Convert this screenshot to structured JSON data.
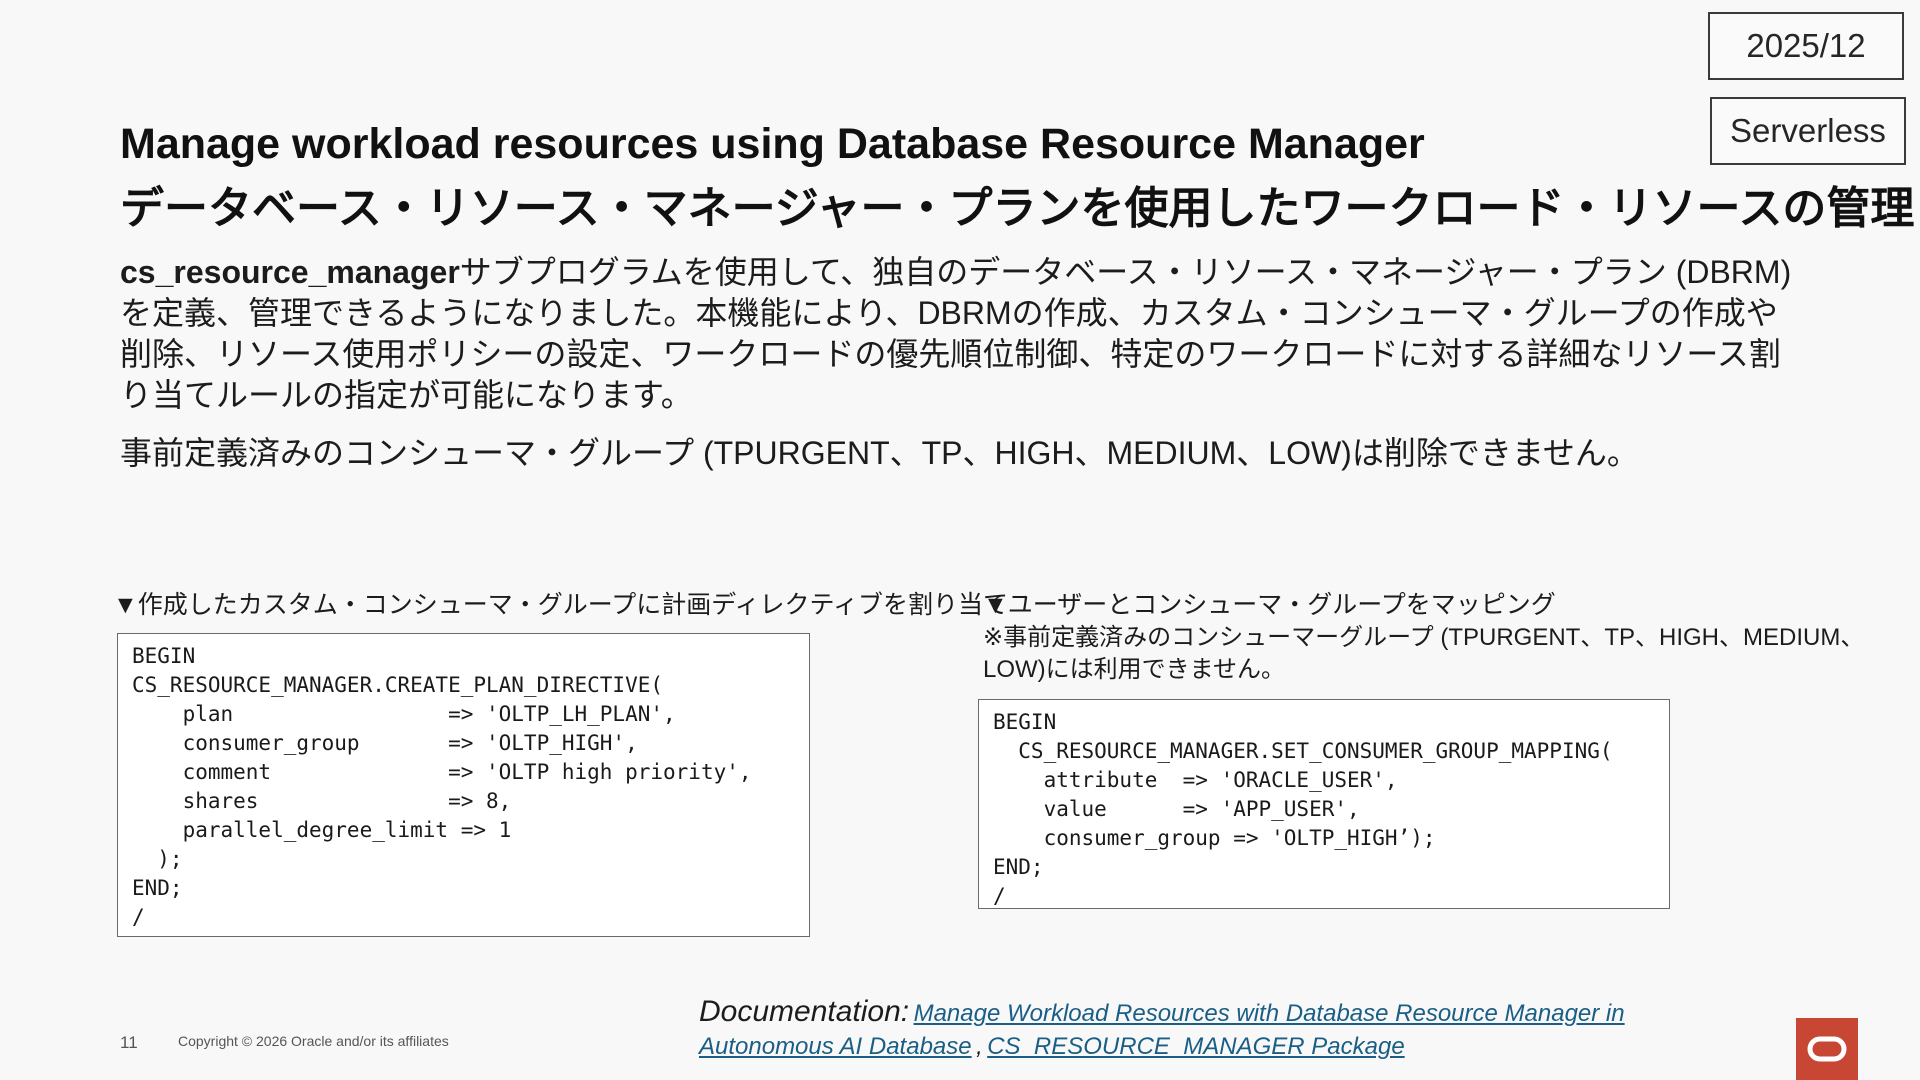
{
  "badges": {
    "date": "2025/12",
    "type": "Serverless"
  },
  "title": {
    "en": "Manage workload resources using Database Resource Manager",
    "ja": "データベース・リソース・マネージャー・プランを使用したワークロード・リソースの管理"
  },
  "body": {
    "bold_prefix": "cs_resource_manager",
    "para1_rest": "サブプログラムを使用して、独自のデータベース・リソース・マネージャー・プラン (DBRM)を定義、管理できるようになりました。本機能により、DBRMの作成、カスタム・コンシューマ・グループの作成や削除、リソース使用ポリシーの設定、ワークロードの優先順位制御、特定のワークロードに対する詳細なリソース割り当てルールの指定が可能になります。",
    "para2": "事前定義済みのコンシューマ・グループ (TPURGENT、TP、HIGH、MEDIUM、LOW)は削除できません。"
  },
  "left_section": {
    "heading": "▼作成したカスタム・コンシューマ・グループに計画ディレクティブを割り当て",
    "code": [
      "BEGIN",
      "CS_RESOURCE_MANAGER.CREATE_PLAN_DIRECTIVE(",
      "    plan                 => 'OLTP_LH_PLAN',",
      "    consumer_group       => 'OLTP_HIGH',",
      "    comment              => 'OLTP high priority',",
      "    shares               => 8,",
      "    parallel_degree_limit => 1",
      "  );",
      "END;",
      "/"
    ]
  },
  "right_section": {
    "heading": "▼ユーザーとコンシューマ・グループをマッピング",
    "note": "※事前定義済みのコンシューマーグループ (TPURGENT、TP、HIGH、MEDIUM、LOW)には利用できません。",
    "code": [
      "BEGIN",
      "  CS_RESOURCE_MANAGER.SET_CONSUMER_GROUP_MAPPING(",
      "    attribute  => 'ORACLE_USER',",
      "    value      => 'APP_USER',",
      "    consumer_group => 'OLTP_HIGH’);",
      "END;",
      "/"
    ]
  },
  "footer": {
    "page_number": "11",
    "copyright": "Copyright © 2026 Oracle and/or its affiliates",
    "doc_label": "Documentation:",
    "doc_link1_part1": "Manage Workload Resources with Database Resource Manager in",
    "doc_link1_part2": "Autonomous AI Database",
    "doc_separator": ",",
    "doc_link2": "CS_RESOURCE_MANAGER Package",
    "logo_color": "#c74634"
  }
}
